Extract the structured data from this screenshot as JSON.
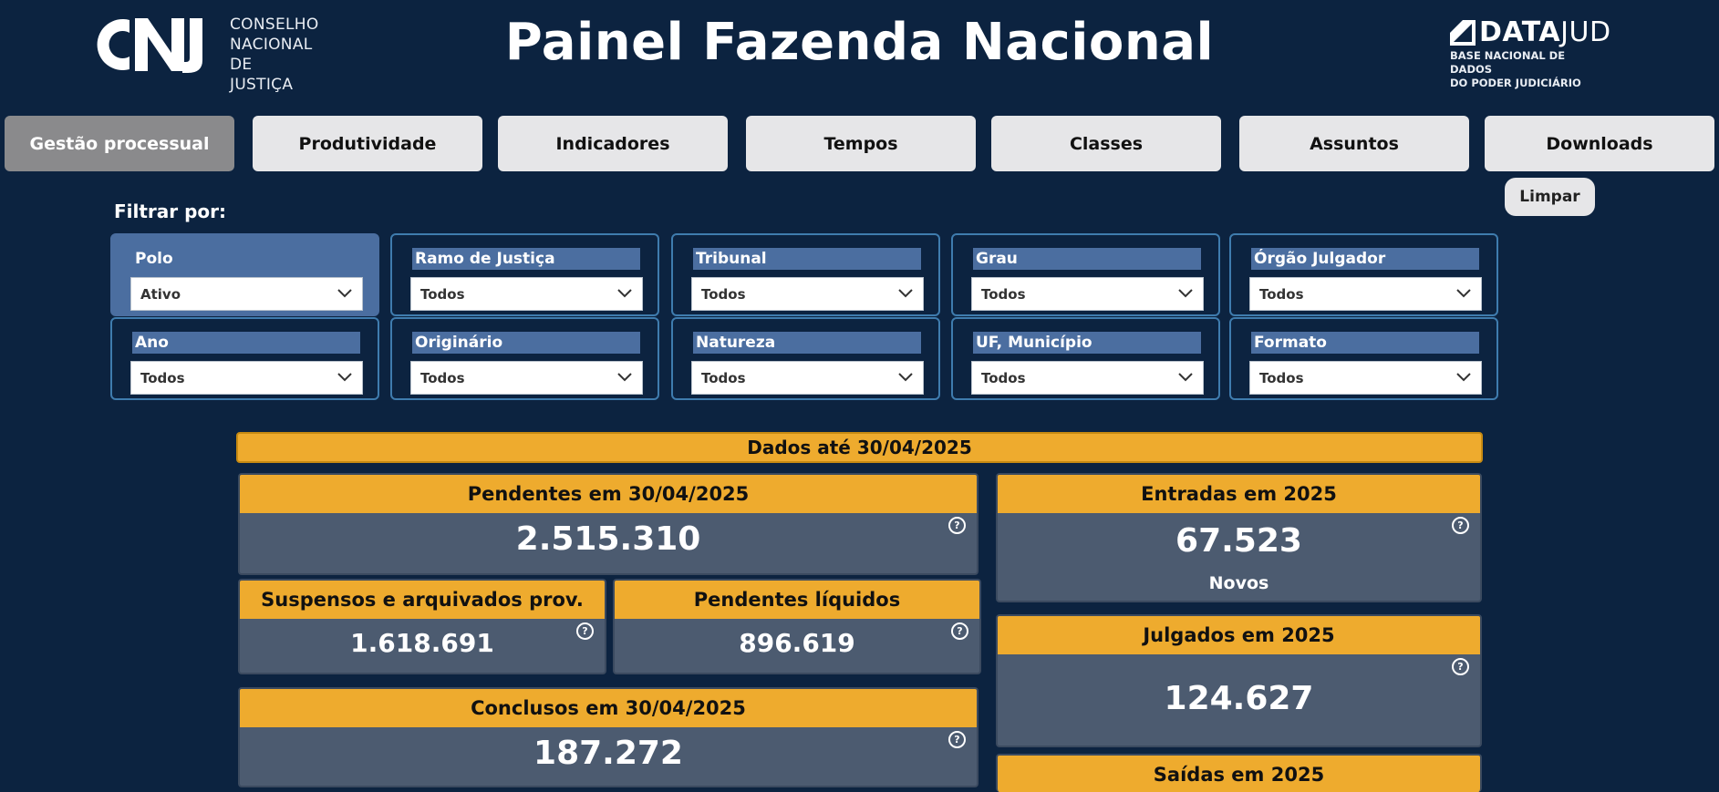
{
  "header": {
    "title": "Painel Fazenda Nacional",
    "cnj": {
      "logo_text": "CNJ",
      "line1": "CONSELHO",
      "line2": "NACIONAL",
      "line3": "DE JUSTIÇA"
    },
    "datajud": {
      "name_bold": "DATA",
      "name_light": "JUD",
      "sub1": "BASE NACIONAL DE DADOS",
      "sub2": "DO PODER JUDICIÁRIO"
    }
  },
  "tabs": [
    {
      "label": "Gestão processual",
      "active": true
    },
    {
      "label": "Produtividade"
    },
    {
      "label": "Indicadores"
    },
    {
      "label": "Tempos"
    },
    {
      "label": "Classes"
    },
    {
      "label": "Assuntos"
    },
    {
      "label": "Downloads"
    }
  ],
  "filters": {
    "label": "Filtrar por:",
    "clear_label": "Limpar",
    "items": [
      {
        "title": "Polo",
        "value": "Ativo"
      },
      {
        "title": "Ramo de Justiça",
        "value": "Todos"
      },
      {
        "title": "Tribunal",
        "value": "Todos"
      },
      {
        "title": "Grau",
        "value": "Todos"
      },
      {
        "title": "Órgão Julgador",
        "value": "Todos"
      },
      {
        "title": "Ano",
        "value": "Todos"
      },
      {
        "title": "Originário",
        "value": "Todos"
      },
      {
        "title": "Natureza",
        "value": "Todos"
      },
      {
        "title": "UF, Município",
        "value": "Todos"
      },
      {
        "title": "Formato",
        "value": "Todos"
      }
    ]
  },
  "date_bar": "Dados até 30/04/2025",
  "cards": {
    "pendentes": {
      "title": "Pendentes em 30/04/2025",
      "value": "2.515.310"
    },
    "suspensos": {
      "title": "Suspensos e arquivados prov.",
      "value": "1.618.691"
    },
    "liquidos": {
      "title": "Pendentes líquidos",
      "value": "896.619"
    },
    "conclusos": {
      "title": "Conclusos em 30/04/2025",
      "value": "187.272"
    },
    "entradas": {
      "title": "Entradas em 2025",
      "value": "67.523",
      "sub": "Novos"
    },
    "julgados": {
      "title": "Julgados em 2025",
      "value": "124.627"
    },
    "saidas": {
      "title": "Saídas em 2025"
    }
  },
  "help_glyph": "?"
}
